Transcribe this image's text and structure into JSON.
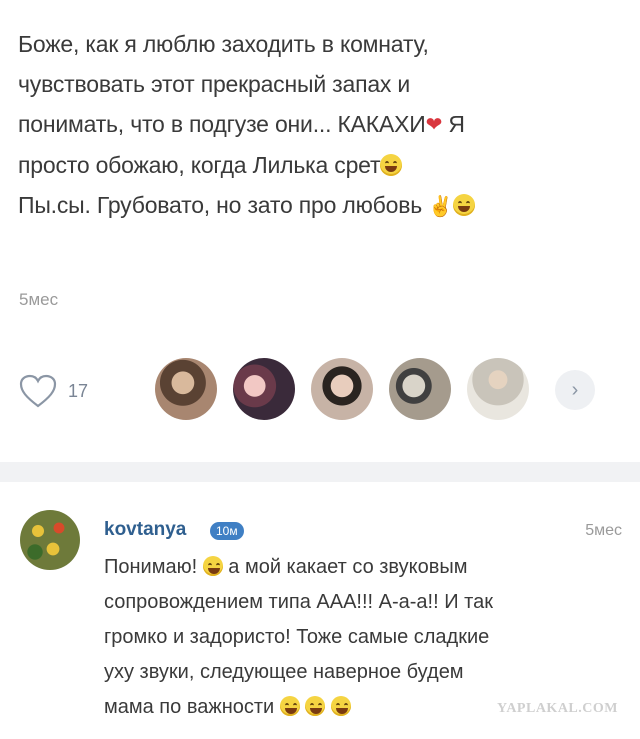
{
  "post": {
    "line1": "Боже, как я люблю заходить в комнату,",
    "line2": "чувствовать этот прекрасный запах и",
    "line3_a": "понимать,  что в подгузе они... КАКАХИ",
    "line3_b": " Я",
    "line4": "просто обожаю, когда Лилька срет",
    "line5": "Пы.сы. Грубовато, но зато про любовь ",
    "time": "5мес",
    "likes": "17",
    "icons": [
      "heart-icon",
      "smile-emoji",
      "victory-emoji",
      "chevron-right-icon"
    ]
  },
  "comment": {
    "author": "kovtanya",
    "badge": "10м",
    "time": "5мес",
    "line1_a": "Понимаю! ",
    "line1_b": " а мой какает со звуковым",
    "line2": "сопровождением типа ААА!!! А-а-а!! И так",
    "line3": "громко и задористо! Тоже самые сладкие",
    "line4": "уху звуки, следующее наверное будем",
    "line5": "мама по важности "
  },
  "watermark": "YAPLAKAL.COM",
  "colors": {
    "name": "#2f5f8f",
    "badge": "#3f7fc4",
    "heart": "#d9363e",
    "divider": "#f1f2f4"
  }
}
